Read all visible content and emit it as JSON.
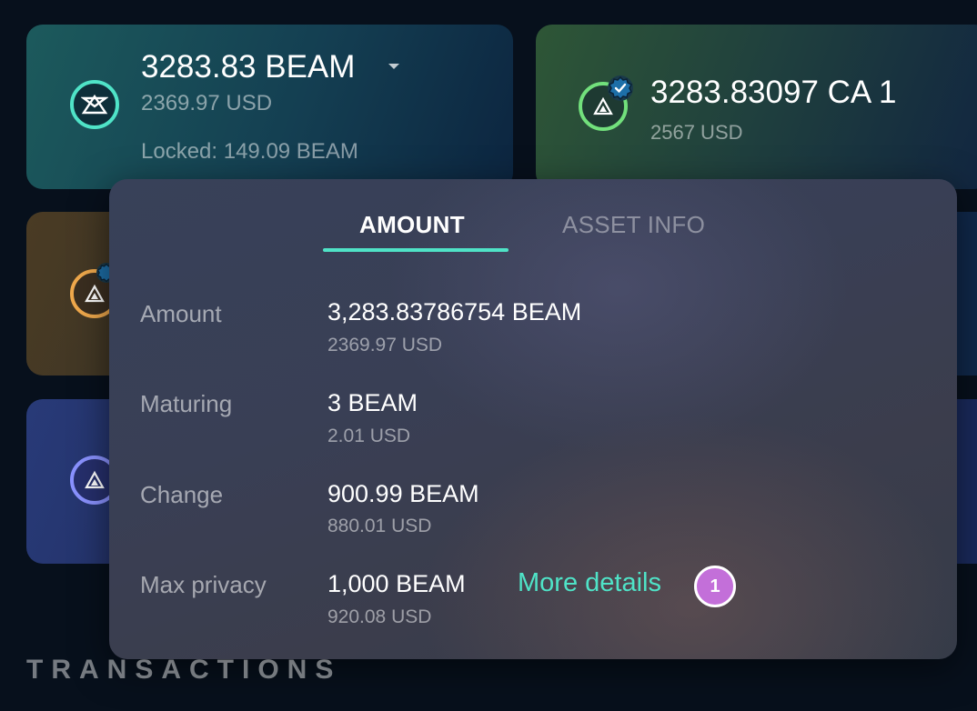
{
  "cards": {
    "beam": {
      "amount": "3283.83 BEAM",
      "usd": "2369.97 USD",
      "locked": "Locked: 149.09 BEAM",
      "accent": "#4fe3c7"
    },
    "ca1": {
      "amount": "3283.83097 CA 1",
      "usd": "2567 USD",
      "accent": "#72e07c"
    },
    "orange": {
      "accent": "#f0a94c"
    },
    "blue": {
      "accent": "#8a92ff"
    }
  },
  "popup": {
    "tabs": [
      {
        "label": "AMOUNT",
        "active": true
      },
      {
        "label": "ASSET INFO",
        "active": false
      }
    ],
    "rows": [
      {
        "label": "Amount",
        "value": "3,283.83786754 BEAM",
        "usd": "2369.97 USD"
      },
      {
        "label": "Maturing",
        "value": "3 BEAM",
        "usd": "2.01 USD"
      },
      {
        "label": "Change",
        "value": "900.99 BEAM",
        "usd": "880.01 USD"
      },
      {
        "label": "Max privacy",
        "value": "1,000 BEAM",
        "usd": "920.08 USD"
      }
    ],
    "more_details": "More details",
    "accent": "#4fe3c7"
  },
  "step_badge": "1",
  "section_title": "TRANSACTIONS"
}
